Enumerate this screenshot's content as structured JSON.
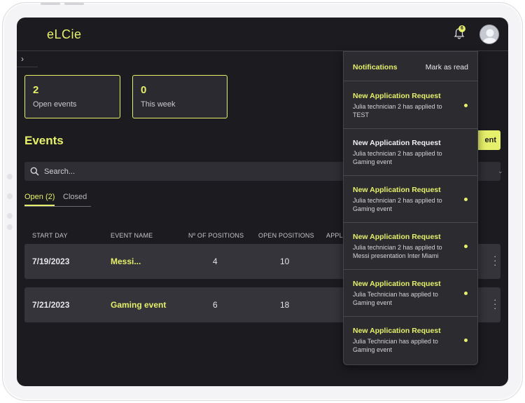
{
  "app": {
    "logo": "eLCie",
    "notification_count": "6"
  },
  "stats": [
    {
      "value": "2",
      "label": "Open events"
    },
    {
      "value": "0",
      "label": "This week"
    }
  ],
  "page": {
    "title": "Events",
    "create_label": "ent"
  },
  "search": {
    "placeholder": "Search..."
  },
  "tabs": {
    "open": "Open (2)",
    "closed": "Closed"
  },
  "table": {
    "columns": [
      "START DAY",
      "EVENT NAME",
      "Nº OF POSITIONS",
      "OPEN POSITIONS",
      "APPLI"
    ],
    "rows": [
      {
        "start_day": "7/19/2023",
        "event_name": "Messi...",
        "positions": "4",
        "open_positions": "10"
      },
      {
        "start_day": "7/21/2023",
        "event_name": "Gaming event",
        "positions": "6",
        "open_positions": "18"
      }
    ]
  },
  "notifications": {
    "title": "Notifications",
    "mark_read": "Mark as read",
    "items": [
      {
        "title": "New Application Request",
        "body": "Julia technician 2 has applied to TEST",
        "unread": true
      },
      {
        "title": "New Application Request",
        "body": "Julia technician 2 has applied to Gaming event",
        "unread": false
      },
      {
        "title": "New Application Request",
        "body": "Julia technician 2 has applied to Gaming event",
        "unread": true
      },
      {
        "title": "New Application Request",
        "body": "Julia technician 2 has applied to Messi presentation Inter Miami",
        "unread": true
      },
      {
        "title": "New Application Request",
        "body": "Julia Technician has applied to Gaming event",
        "unread": true
      },
      {
        "title": "New Application Request",
        "body": "Julia Technician has applied to Gaming event",
        "unread": true
      }
    ]
  },
  "colors": {
    "accent": "#e6f06a",
    "background": "#1c1c20",
    "row": "#34343a",
    "read_title": "#f2f2f4"
  }
}
